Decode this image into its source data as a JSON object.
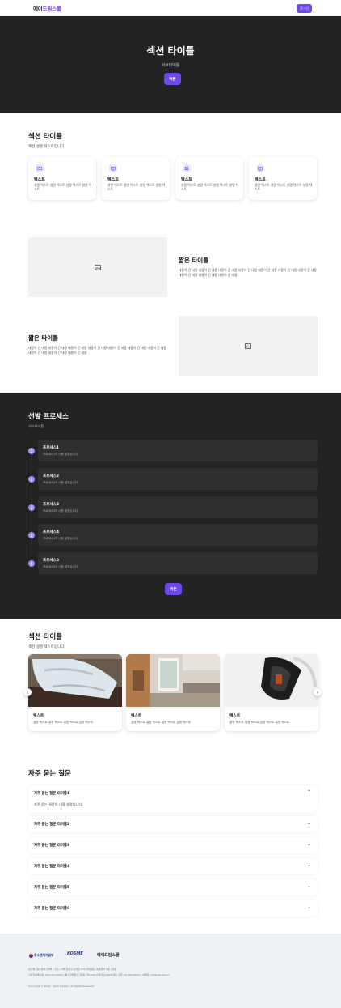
{
  "header": {
    "logo_main": "에이",
    "logo_accent": "드림스쿨",
    "login_label": "로그인"
  },
  "hero": {
    "title": "섹션 타이틀",
    "subtitle": "서브타이틀",
    "button_label": "버튼"
  },
  "features": {
    "title": "섹션 타이틀",
    "description": "섹션 설명 텍스트입니다.",
    "cards": [
      {
        "icon": "picture-icon",
        "title": "텍스트",
        "desc": "설명 텍스트 설명 텍스트 설명 텍스트 설명 텍스트"
      },
      {
        "icon": "book-icon",
        "title": "텍스트",
        "desc": "설명 텍스트 설명 텍스트 설명 텍스트 설명 텍스트"
      },
      {
        "icon": "laptop-icon",
        "title": "텍스트",
        "desc": "설명 텍스트 설명 텍스트 설명 텍스트 설명 텍스트"
      },
      {
        "icon": "book-icon",
        "title": "텍스트",
        "desc": "설명 텍스트 설명 텍스트 설명 텍스트 설명 텍스트"
      }
    ]
  },
  "feature_row1": {
    "title": "짧은 타이틀",
    "text": "내용이 긴 내용 내용이 긴 내용 내용이 긴 내용 내용이 긴 내용 내용이 긴 내용 내용이 긴 내용 내용이 긴 내용 내용이 긴 내용 내용이 긴 내용 내용이 긴 내용"
  },
  "feature_row2": {
    "title": "짧은 타이틀",
    "text": "내용이 긴 내용 내용이 긴 내용 내용이 긴 내용 내용이 긴 내용 내용이 긴 내용 내용이 긴 내용 내용이 긴 내용 내용이 긴 내용 내용이 긴 내용 내용이 긴 내용"
  },
  "process": {
    "title": "선발 프로세스",
    "subtitle": "서브타이틀",
    "steps": [
      {
        "num": "1",
        "title": "프로세스1",
        "desc": "프로세스1의 내용 설명입니다."
      },
      {
        "num": "2",
        "title": "프로세스2",
        "desc": "프로세스2의 내용 설명입니다."
      },
      {
        "num": "3",
        "title": "프로세스3",
        "desc": "프로세스3의 내용 설명입니다."
      },
      {
        "num": "4",
        "title": "프로세스4",
        "desc": "프로세스4의 내용 설명입니다."
      },
      {
        "num": "5",
        "title": "프로세스5",
        "desc": "프로세스5의 내용 설명입니다."
      }
    ],
    "button_label": "버튼"
  },
  "gallery": {
    "title": "섹션 타이틀",
    "description": "섹션 설명 텍스트입니다.",
    "cards": [
      {
        "title": "텍스트",
        "desc": "설명 텍스트 설명 텍스트 설명 텍스트 설명 텍스트"
      },
      {
        "title": "텍스트",
        "desc": "설명 텍스트 설명 텍스트 설명 텍스트 설명 텍스트"
      },
      {
        "title": "텍스트",
        "desc": "설명 텍스트 설명 텍스트 설명 텍스트 설명 텍스트"
      }
    ]
  },
  "faq": {
    "title": "자주 묻는 질문",
    "items": [
      {
        "q": "자주 묻는 질문 타이틀1",
        "a": "자주 묻는 질문의 내용 설명입니다.",
        "open": true
      },
      {
        "q": "자주 묻는 질문 타이틀2"
      },
      {
        "q": "자주 묻는 질문 타이틀3"
      },
      {
        "q": "자주 묻는 질문 타이틀4"
      },
      {
        "q": "자주 묻는 질문 타이틀5"
      },
      {
        "q": "자주 묻는 질문 타이틀6"
      }
    ]
  },
  "footer": {
    "logos": [
      "중소벤처기업부",
      "KOSME",
      "에이드림스쿨"
    ],
    "info_line1": "법인명: 중소벤처기업부 | 주소: 서울 강남구 논현로 123 (역삼동), 세종청사 5층 | 대표",
    "info_line2": "사업자등록번호: 000-00-00000 | 통신판매업신고번호: 제2024-서울강남-00000호 | 전화: 02-000-0000 | 이메일: info@adream.kr",
    "copyright": "Copyright © 2018 - 2023 adream. All Rights Reserved."
  },
  "colors": {
    "accent": "#6d4ae8",
    "dark_bg": "#232323",
    "footer_bg": "#eef1f5"
  }
}
